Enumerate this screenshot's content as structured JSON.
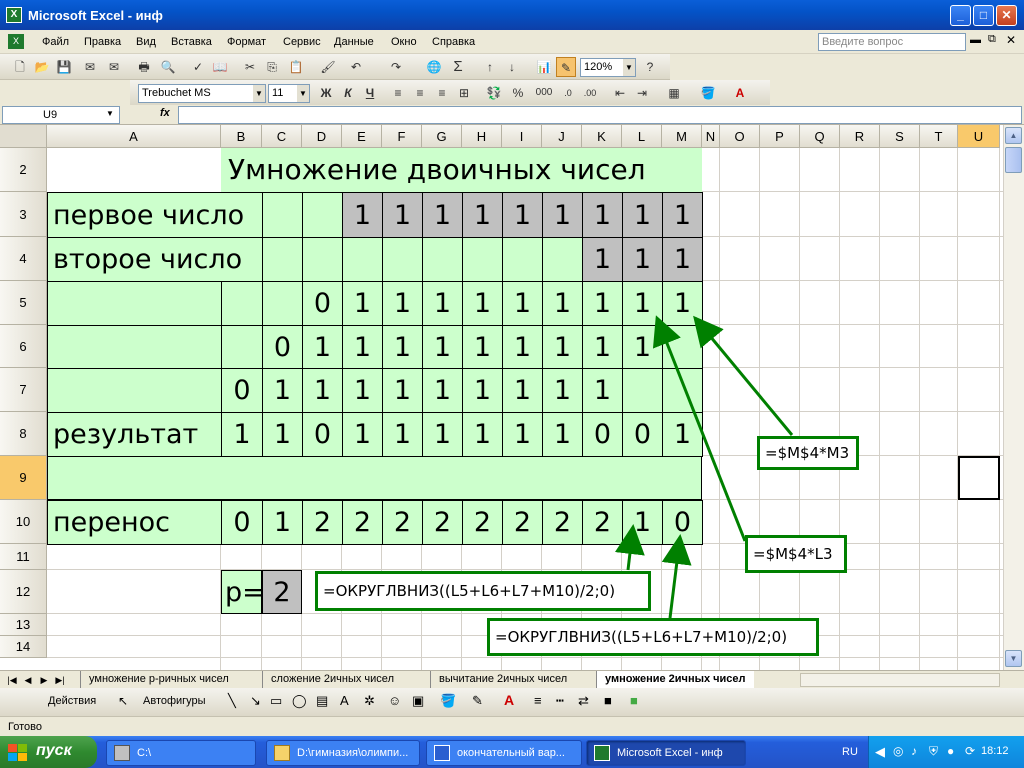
{
  "window": {
    "title": "Microsoft Excel - инф",
    "app_icon": "X"
  },
  "menu": [
    "Файл",
    "Правка",
    "Вид",
    "Вставка",
    "Формат",
    "Сервис",
    "Данные",
    "Окно",
    "Справка"
  ],
  "help_placeholder": "Введите вопрос",
  "toolbar": {
    "zoom": "120%",
    "font": "Trebuchet MS",
    "size": "11",
    "bold": "Ж",
    "italic": "К",
    "underline": "Ч",
    "percent": "%",
    "thousands": "000"
  },
  "namebox": "U9",
  "fx": "fx",
  "formula": "",
  "columns": [
    "A",
    "B",
    "C",
    "D",
    "E",
    "F",
    "G",
    "H",
    "I",
    "J",
    "K",
    "L",
    "M",
    "N",
    "O",
    "P",
    "Q",
    "R",
    "S",
    "T",
    "U"
  ],
  "rows": [
    "2",
    "3",
    "4",
    "5",
    "6",
    "7",
    "8",
    "9",
    "10",
    "11",
    "12",
    "13",
    "14"
  ],
  "sheet": {
    "title": "Умножение двоичных чисел",
    "row3": {
      "label": "первое число",
      "digits": [
        "1",
        "1",
        "1",
        "1",
        "1",
        "1",
        "1",
        "1",
        "1"
      ]
    },
    "row4": {
      "label": "второе число",
      "digits": [
        "1",
        "1",
        "1"
      ]
    },
    "row5": [
      "0",
      "1",
      "1",
      "1",
      "1",
      "1",
      "1",
      "1",
      "1",
      "1"
    ],
    "row6": [
      "0",
      "1",
      "1",
      "1",
      "1",
      "1",
      "1",
      "1",
      "1",
      "1"
    ],
    "row7": [
      "0",
      "1",
      "1",
      "1",
      "1",
      "1",
      "1",
      "1",
      "1",
      "1"
    ],
    "row8": {
      "label": "результат",
      "digits": [
        "1",
        "1",
        "0",
        "1",
        "1",
        "1",
        "1",
        "1",
        "1",
        "0",
        "0",
        "1"
      ]
    },
    "row10": {
      "label": "перенос",
      "digits": [
        "0",
        "1",
        "2",
        "2",
        "2",
        "2",
        "2",
        "2",
        "2",
        "2",
        "1",
        "0"
      ]
    },
    "row12": {
      "label": "p=",
      "value": "2"
    }
  },
  "annotations": {
    "m3": "=$M$4*M3",
    "l3": "=$M$4*L3",
    "round1": "=ОКРУГЛВНИЗ((L5+L6+L7+M10)/2;0)",
    "round2": "=ОКРУГЛВНИЗ((L5+L6+L7+M10)/2;0)"
  },
  "tabs": [
    "умножение р-ричных чисел",
    "сложение 2ичных чисел",
    "вычитание 2ичных чисел",
    "умножение 2ичных чисел"
  ],
  "drawbar": {
    "actions": "Действия",
    "autoshapes": "Автофигуры"
  },
  "status": "Готово",
  "taskbar": {
    "start": "пуск",
    "tasks": [
      "C:\\",
      "D:\\гимназия\\олимпи...",
      "окончательный вар...",
      "Microsoft Excel - инф"
    ],
    "lang": "RU",
    "clock": "18:12"
  },
  "colors": {
    "green_fill": "#ccffcc",
    "gray_fill": "#c0c0c0",
    "arrow": "#008000",
    "selected_header": "#f9c96b"
  }
}
